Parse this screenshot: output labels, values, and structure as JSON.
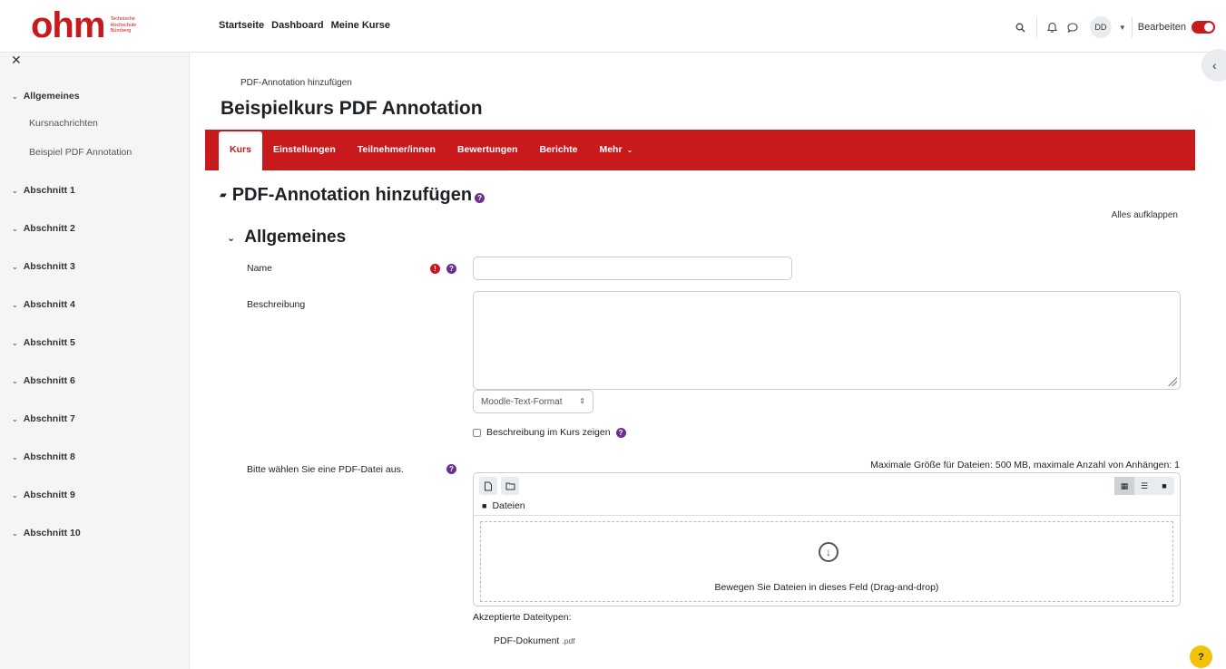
{
  "logo": {
    "wordmark": "ohm",
    "subtitle_lines": [
      "Technische",
      "Hochschule",
      "Nürnberg"
    ]
  },
  "primary_nav": [
    "Startseite",
    "Dashboard",
    "Meine Kurse"
  ],
  "user": {
    "initials": "DD",
    "edit_mode_label": "Bearbeiten",
    "edit_mode_on": true
  },
  "icons": {
    "search": "search-icon",
    "notifications": "bell-icon",
    "messages": "message-icon",
    "close_drawer": "close-icon",
    "open_block_drawer": "chevron-left-icon"
  },
  "sidebar": {
    "sections": [
      {
        "label": "Allgemeines",
        "links": [
          "Kursnachrichten",
          "Beispiel PDF Annotation"
        ]
      },
      {
        "label": "Abschnitt 1",
        "links": []
      },
      {
        "label": "Abschnitt 2",
        "links": []
      },
      {
        "label": "Abschnitt 3",
        "links": []
      },
      {
        "label": "Abschnitt 4",
        "links": []
      },
      {
        "label": "Abschnitt 5",
        "links": []
      },
      {
        "label": "Abschnitt 6",
        "links": []
      },
      {
        "label": "Abschnitt 7",
        "links": []
      },
      {
        "label": "Abschnitt 8",
        "links": []
      },
      {
        "label": "Abschnitt 9",
        "links": []
      },
      {
        "label": "Abschnitt 10",
        "links": []
      }
    ]
  },
  "breadcrumb": "PDF-Annotation hinzufügen",
  "course_title": "Beispielkurs PDF Annotation",
  "secondary_nav": {
    "tabs": [
      "Kurs",
      "Einstellungen",
      "Teilnehmer/innen",
      "Bewertungen",
      "Berichte",
      "Mehr"
    ],
    "active": "Kurs"
  },
  "page_heading": "PDF-Annotation hinzufügen",
  "expand_all": "Alles aufklappen",
  "section": {
    "title": "Allgemeines",
    "fields": {
      "name": {
        "label": "Name",
        "value": "",
        "required": true
      },
      "description": {
        "label": "Beschreibung",
        "value": "",
        "format": "Moodle-Text-Format"
      },
      "show_description": {
        "label": "Beschreibung im Kurs zeigen",
        "checked": false
      },
      "pdf_file": {
        "label": "Bitte wählen Sie eine PDF-Datei aus.",
        "limits": "Maximale Größe für Dateien: 500 MB, maximale Anzahl von Anhängen: 1",
        "folder": "Dateien",
        "dropzone_text": "Bewegen Sie Dateien in dieses Feld (Drag-and-drop)",
        "accepted_label": "Akzeptierte Dateitypen:",
        "accepted_type": "PDF-Dokument",
        "accepted_ext": ".pdf"
      }
    }
  },
  "colors": {
    "brand_red": "#c8191c",
    "help_purple": "#6a2f8f",
    "help_fab_yellow": "#f4c20d"
  },
  "help_fab_label": "?"
}
